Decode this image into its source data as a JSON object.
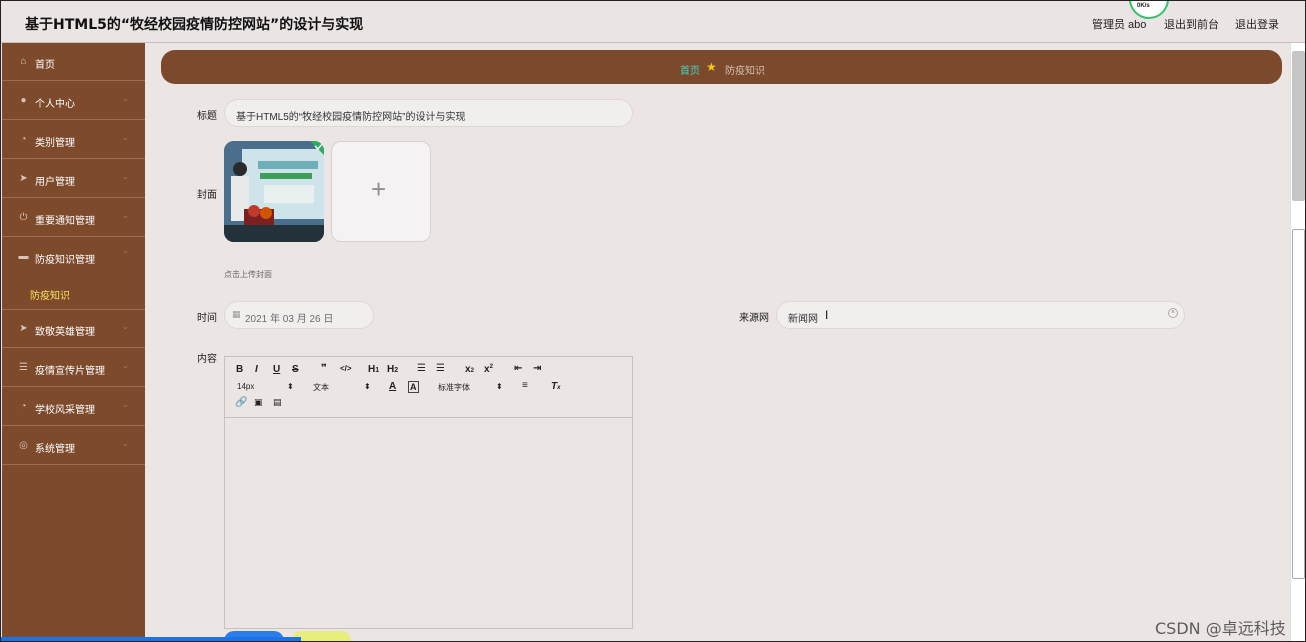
{
  "header": {
    "title": "基于HTML5的“牧经校园疫情防控网站”的设计与实现",
    "user": "管理员 abo",
    "to_front": "退出到前台",
    "logout": "退出登录",
    "speed": "0K/s"
  },
  "sidebar": {
    "items": [
      {
        "label": "首页",
        "icon": "home-icon"
      },
      {
        "label": "个人中心",
        "icon": "user-icon"
      },
      {
        "label": "类别管理",
        "icon": "gauge-icon"
      },
      {
        "label": "用户管理",
        "icon": "send-icon"
      },
      {
        "label": "重要通知管理",
        "icon": "power-icon"
      },
      {
        "label": "防疫知识管理",
        "icon": "book-icon"
      },
      {
        "label": "致敬英雄管理",
        "icon": "send-icon"
      },
      {
        "label": "疫情宣传片管理",
        "icon": "sliders-icon"
      },
      {
        "label": "学校风采管理",
        "icon": "gauge-icon"
      },
      {
        "label": "系统管理",
        "icon": "globe-icon"
      }
    ],
    "sub_item": "防疫知识"
  },
  "breadcrumb": {
    "home": "首页",
    "current": "防疫知识"
  },
  "form": {
    "title_label": "标题",
    "title_value": "基于HTML5的“牧经校园疫情防控网站”的设计与实现",
    "cover_label": "封面",
    "cover_hint": "点击上传封面",
    "time_label": "时间",
    "time_value": "2021 年 03 月 26 日",
    "source_label": "来源网",
    "source_value": "新闻网",
    "content_label": "内容"
  },
  "editor": {
    "font_size": "14px",
    "format": "文本",
    "font_family": "标准字体"
  },
  "watermark": "CSDN @卓远科技"
}
